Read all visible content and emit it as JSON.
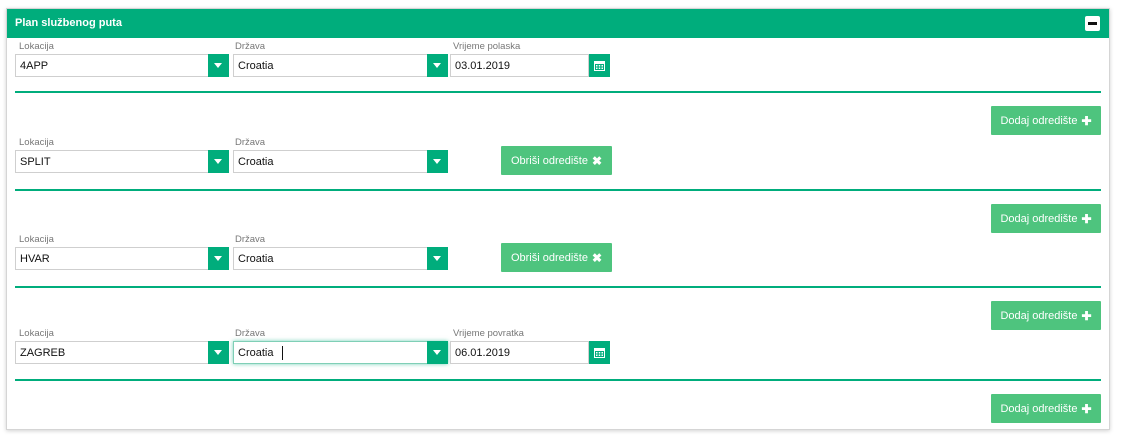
{
  "panel": {
    "title": "Plan službenog puta"
  },
  "labels": {
    "location": "Lokacija",
    "country": "Država",
    "departure_time": "Vrijeme polaska",
    "return_time": "Vrijeme povratka"
  },
  "buttons": {
    "add_destination": "Dodaj odredište",
    "remove_destination": "Obriši odredište"
  },
  "icons": {
    "collapse": "minus-icon",
    "dropdown": "chevron-down-icon",
    "calendar": "calendar-icon",
    "add": "plus-icon",
    "remove": "x-icon"
  },
  "rows": [
    {
      "location": "4APP",
      "country": "Croatia",
      "date": "03.01.2019"
    },
    {
      "location": "SPLIT",
      "country": "Croatia"
    },
    {
      "location": "HVAR",
      "country": "Croatia"
    },
    {
      "location": "ZAGREB",
      "country": "Croatia",
      "date": "06.01.2019"
    }
  ],
  "colors": {
    "primary": "#00ad7c",
    "button": "#4ec47e"
  }
}
